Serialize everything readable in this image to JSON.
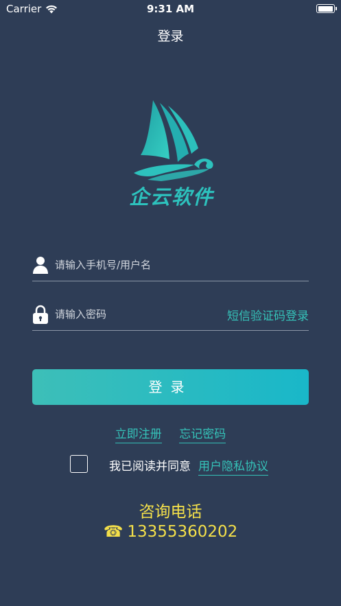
{
  "status_bar": {
    "carrier": "Carrier",
    "time": "9:31 AM",
    "battery_level": 1.0
  },
  "nav": {
    "title": "登录"
  },
  "logo": {
    "text": "企云软件",
    "color": "#2dc2bd"
  },
  "form": {
    "username": {
      "value": "",
      "placeholder": "请输入手机号/用户名",
      "icon": "user-icon"
    },
    "password": {
      "value": "",
      "placeholder": "请输入密码",
      "icon": "lock-icon"
    },
    "sms_login_label": "短信验证码登录"
  },
  "login_button": {
    "label": "登录"
  },
  "links": {
    "register": "立即注册",
    "forgot_password": "忘记密码"
  },
  "agreement": {
    "checked": false,
    "text": "我已阅读并同意",
    "link_text": "用户隐私协议"
  },
  "contact": {
    "title": "咨询电话",
    "phone_icon": "☎",
    "phone": "13355360202"
  },
  "colors": {
    "background": "#2e3d56",
    "accent": "#35c3b9",
    "contact": "#f4e04a"
  }
}
